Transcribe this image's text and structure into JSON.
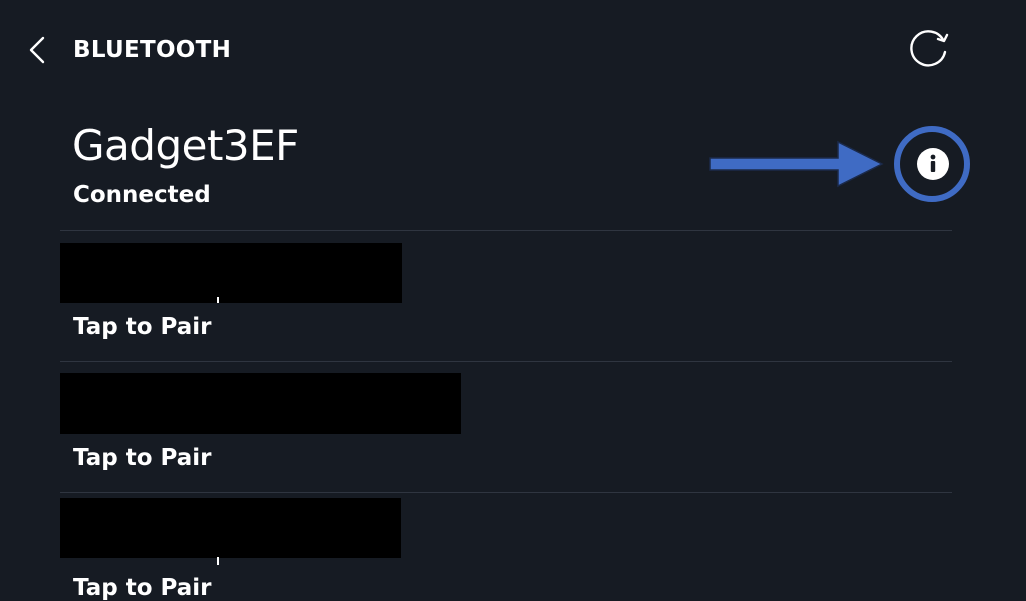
{
  "header": {
    "title": "BLUETOOTH",
    "back_icon": "chevron-left-icon",
    "refresh_icon": "refresh-icon"
  },
  "connected_device": {
    "name": "Gadget3EF",
    "status": "Connected",
    "info_icon": "info-icon"
  },
  "available_devices": [
    {
      "name": "",
      "status": "Tap to Pair"
    },
    {
      "name": "",
      "status": "Tap to Pair"
    },
    {
      "name": "",
      "status": "Tap to Pair"
    }
  ],
  "colors": {
    "background": "#161b23",
    "text": "#ffffff",
    "divider": "#2f3540",
    "annotation": "#3f6bc4",
    "redaction": "#000000"
  }
}
